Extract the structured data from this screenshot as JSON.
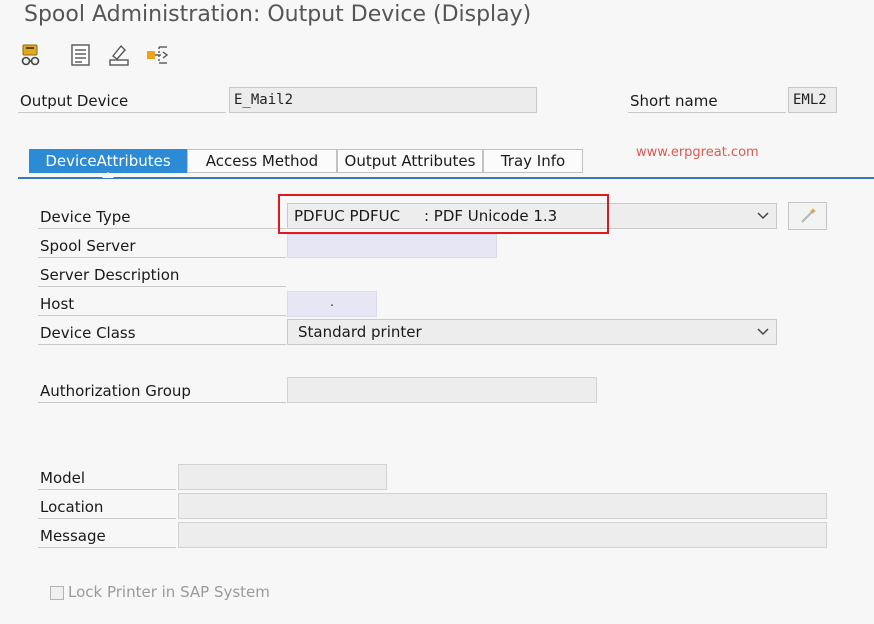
{
  "window": {
    "title": "Spool Administration: Output Device (Display)"
  },
  "toolbar": [
    {
      "name": "other-object-icon"
    },
    {
      "name": "list-icon"
    },
    {
      "name": "edit-icon"
    },
    {
      "name": "hierarchy-icon"
    }
  ],
  "header": {
    "output_device_label": "Output Device",
    "output_device_value": "E_Mail2",
    "short_name_label": "Short name",
    "short_name_value": "EML2"
  },
  "tabs": [
    {
      "label": "DeviceAttributes",
      "active": true
    },
    {
      "label": "Access Method",
      "active": false
    },
    {
      "label": "Output Attributes",
      "active": false
    },
    {
      "label": "Tray Info",
      "active": false
    }
  ],
  "watermark": "www.erpgreat.com",
  "form": {
    "device_type_label": "Device Type",
    "device_type_value": "PDFUC PDFUC     : PDF Unicode 1.3",
    "spool_server_label": "Spool Server",
    "server_description_label": "Server Description",
    "host_label": "Host",
    "host_value": ".",
    "device_class_label": "Device Class",
    "device_class_value": "Standard printer",
    "authorization_group_label": "Authorization Group",
    "model_label": "Model",
    "location_label": "Location",
    "message_label": "Message",
    "lock_printer_label": "Lock Printer in SAP System",
    "lock_printer_checked": false
  },
  "colors": {
    "active_tab": "#2d8bd6",
    "tab_underline": "#3a79b8",
    "highlight_box": "#e0191e",
    "watermark": "#e25555"
  }
}
